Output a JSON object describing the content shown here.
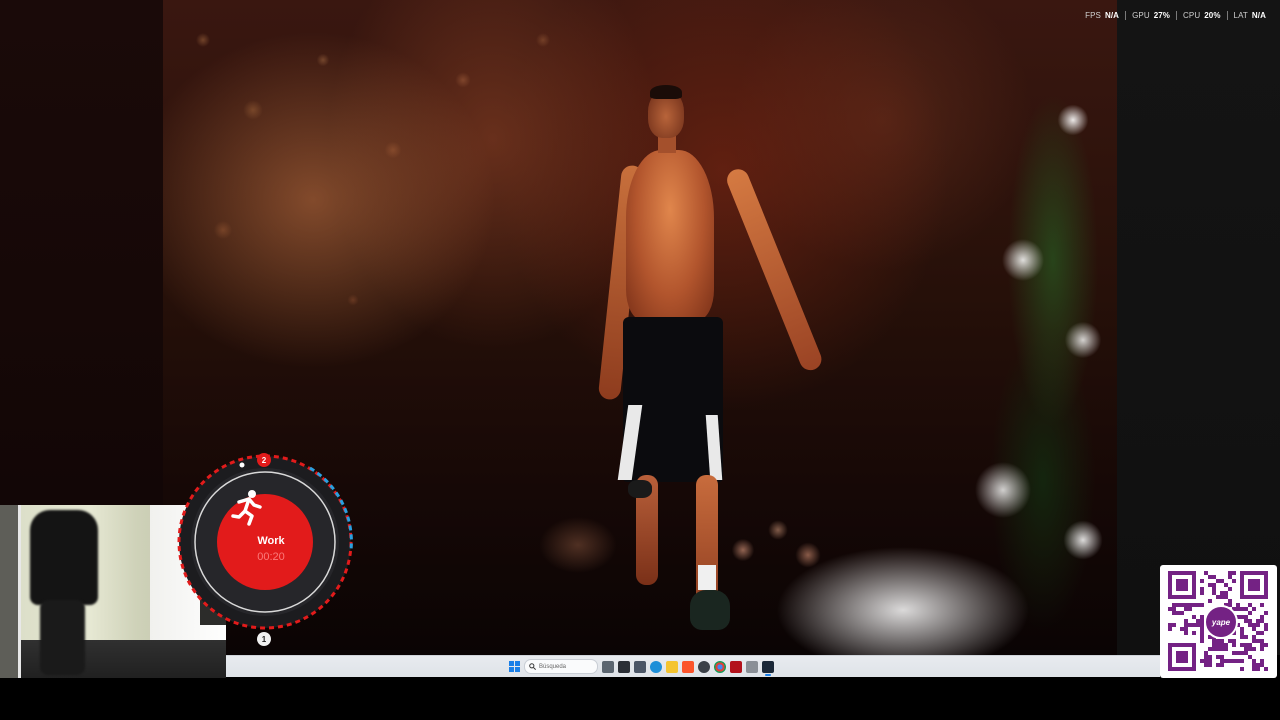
{
  "stats": [
    {
      "key": "FPS",
      "value": "N/A"
    },
    {
      "key": "GPU",
      "value": "27%"
    },
    {
      "key": "CPU",
      "value": "20%"
    },
    {
      "key": "LAT",
      "value": "N/A"
    }
  ],
  "timer": {
    "label": "Work",
    "time": "00:20",
    "round_current": "2",
    "round_next": "1",
    "icon": "running-person-icon",
    "accent_color": "#e21b1b"
  },
  "taskbar": {
    "search_placeholder": "Búsqueda",
    "icons": [
      "windows-start-icon",
      "search-icon",
      "task-view-icon",
      "file-explorer-icon",
      "edge-icon",
      "chrome-icon",
      "folder-icon",
      "brave-icon",
      "app-icon",
      "app-icon",
      "app-icon",
      "app-icon",
      "steam-icon"
    ]
  },
  "qr": {
    "brand": "yape",
    "brand_color": "#742284"
  }
}
